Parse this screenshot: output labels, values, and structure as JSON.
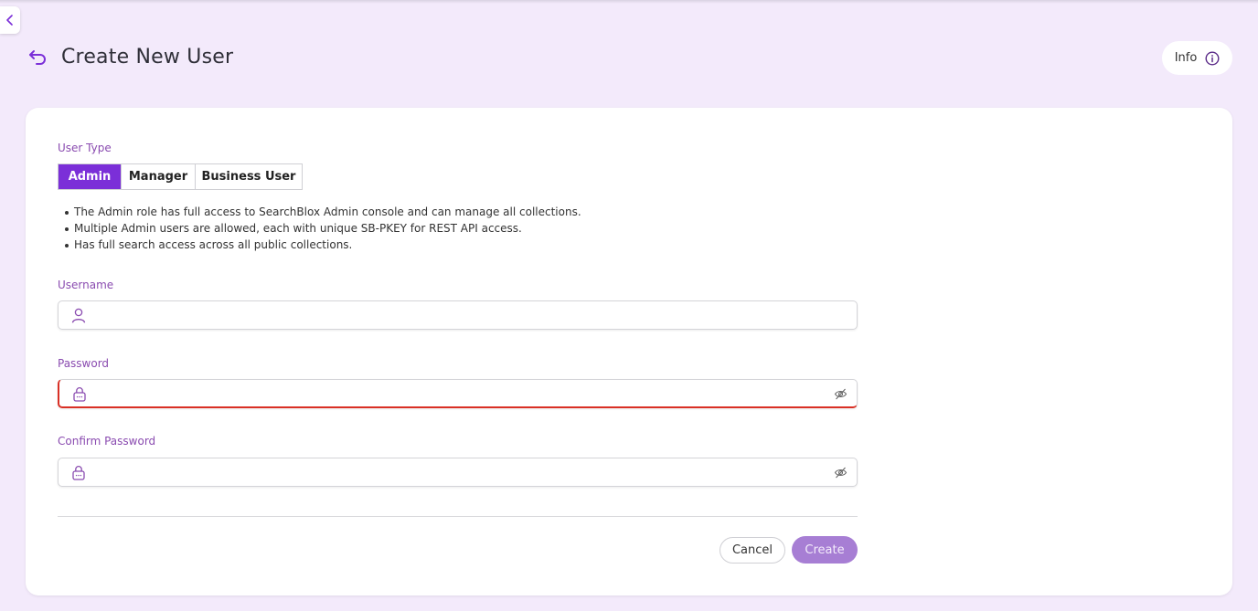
{
  "header": {
    "title": "Create New User",
    "info_label": "Info"
  },
  "form": {
    "user_type_label": "User Type",
    "user_types": [
      "Admin",
      "Manager",
      "Business User"
    ],
    "selected_user_type": "Admin",
    "description": [
      "The Admin role has full access to SearchBlox Admin console and can manage all collections.",
      "Multiple Admin users are allowed, each with unique SB-PKEY for REST API access.",
      "Has full search access across all public collections."
    ],
    "username": {
      "label": "Username",
      "value": "",
      "icon": "user-icon"
    },
    "password": {
      "label": "Password",
      "value": "",
      "icon": "lock-icon",
      "state": "error"
    },
    "confirm_password": {
      "label": "Confirm Password",
      "value": "",
      "icon": "lock-icon"
    },
    "cancel_label": "Cancel",
    "create_label": "Create"
  },
  "colors": {
    "background": "#f3eafb",
    "accent": "#7b2fd8",
    "label": "#8a4bb0",
    "create_disabled": "#a77ed4",
    "error": "#d93025"
  }
}
